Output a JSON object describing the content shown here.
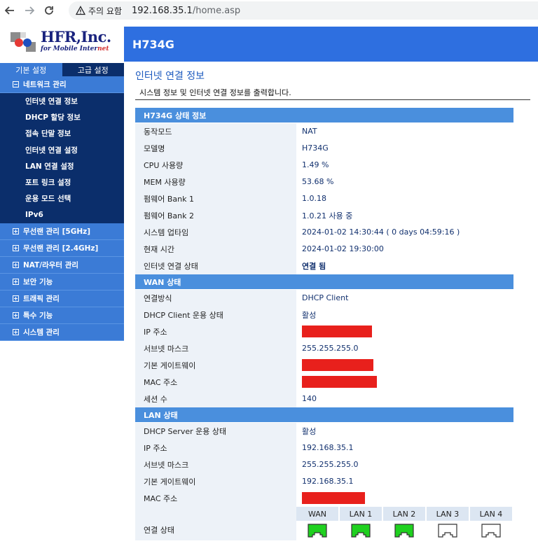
{
  "browser": {
    "security_label": "주의 요함",
    "url_host": "192.168.35.1",
    "url_path": "/home.asp"
  },
  "brand": {
    "name": "HFR,Inc.",
    "tagline_prefix": "for Mobile Inter",
    "tagline_suffix": "net"
  },
  "header": {
    "model": "H734G"
  },
  "tabs": {
    "basic": "기본 설정",
    "advanced": "고급 설정"
  },
  "menu": {
    "network": {
      "label": "네트워크 관리",
      "items": [
        "인터넷 연결 정보",
        "DHCP 할당 정보",
        "접속 단말 정보",
        "인터넷 연결 설정",
        "LAN 연결 설정",
        "포트 링크 설정",
        "운용 모드 선택",
        "IPv6"
      ]
    },
    "groups": [
      "무선랜 관리 [5GHz]",
      "무선랜 관리 [2.4GHz]",
      "NAT/라우터 관리",
      "보안 기능",
      "트래픽 관리",
      "특수 기능",
      "시스템 관리"
    ]
  },
  "page": {
    "title": "인터넷 연결 정보",
    "description": "시스템 정보 및 인터넷 연결 정보를 출력합니다."
  },
  "status": {
    "header": "H734G 상태 정보",
    "rows": [
      {
        "label": "동작모드",
        "value": "NAT"
      },
      {
        "label": "모델명",
        "value": "H734G"
      },
      {
        "label": "CPU 사용량",
        "value": "1.49 %"
      },
      {
        "label": "MEM 사용량",
        "value": "53.68 %"
      },
      {
        "label": "펌웨어 Bank 1",
        "value": "1.0.18"
      },
      {
        "label": "펌웨어 Bank 2",
        "value": "1.0.21 사용 중"
      },
      {
        "label": "시스템 업타임",
        "value": "2024-01-02 14:30:44 ( 0 days 04:59:16 )"
      },
      {
        "label": "현재 시간",
        "value": "2024-01-02 19:30:00"
      },
      {
        "label": "인터넷 연결 상태",
        "value": "연결 됨"
      }
    ]
  },
  "wan": {
    "header": "WAN 상태",
    "rows": [
      {
        "label": "연결방식",
        "value": "DHCP Client"
      },
      {
        "label": "DHCP Client 운용 상태",
        "value": "활성"
      },
      {
        "label": "IP 주소",
        "value": ""
      },
      {
        "label": "서브넷 마스크",
        "value": "255.255.255.0"
      },
      {
        "label": "기본 게이트웨이",
        "value": ""
      },
      {
        "label": "MAC 주소",
        "value": ""
      },
      {
        "label": "세션 수",
        "value": "140"
      }
    ]
  },
  "lan": {
    "header": "LAN 상태",
    "rows": [
      {
        "label": "DHCP Server 운용 상태",
        "value": "활성"
      },
      {
        "label": "IP 주소",
        "value": "192.168.35.1"
      },
      {
        "label": "서브넷 마스크",
        "value": "255.255.255.0"
      },
      {
        "label": "기본 게이트웨이",
        "value": "192.168.35.1"
      },
      {
        "label": "MAC 주소",
        "value": ""
      }
    ],
    "link_label": "연결 상태",
    "ports": [
      {
        "name": "WAN",
        "connected": true
      },
      {
        "name": "LAN 1",
        "connected": true
      },
      {
        "name": "LAN 2",
        "connected": true
      },
      {
        "name": "LAN 3",
        "connected": false
      },
      {
        "name": "LAN 4",
        "connected": false
      }
    ]
  },
  "colors": {
    "accent": "#2e6fe0",
    "menu_blue": "#3b7bd6",
    "menu_navy": "#0b2e6b",
    "port_on": "#1fd11f",
    "redaction": "#e8201c"
  }
}
